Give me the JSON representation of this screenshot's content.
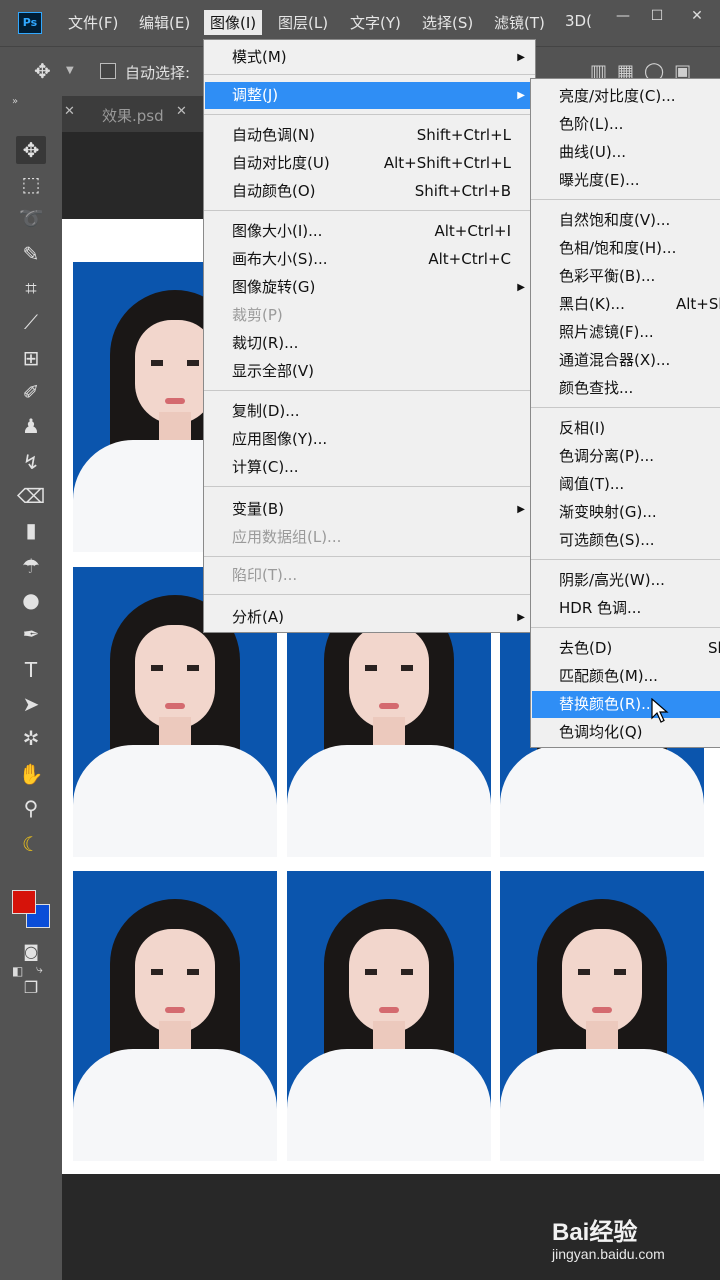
{
  "menubar": {
    "logo": "Ps",
    "items": [
      "文件(F)",
      "编辑(E)",
      "图像(I)",
      "图层(L)",
      "文字(Y)",
      "选择(S)",
      "滤镜(T)",
      "3D("
    ],
    "active_index": 2
  },
  "window_controls": {
    "minimize": "—",
    "maximize": "☐",
    "close": "✕"
  },
  "options_bar": {
    "auto_select_label": "自动选择:",
    "auto_select_checked": false
  },
  "tabs": [
    {
      "label": "效果.psd"
    }
  ],
  "image_menu": {
    "items": [
      {
        "label": "模式(M)",
        "submenu": true
      },
      {
        "label": "调整(J)",
        "submenu": true,
        "highlighted": true
      },
      {
        "label": "自动色调(N)",
        "shortcut": "Shift+Ctrl+L"
      },
      {
        "label": "自动对比度(U)",
        "shortcut": "Alt+Shift+Ctrl+L"
      },
      {
        "label": "自动颜色(O)",
        "shortcut": "Shift+Ctrl+B"
      },
      {
        "label": "图像大小(I)...",
        "shortcut": "Alt+Ctrl+I"
      },
      {
        "label": "画布大小(S)...",
        "shortcut": "Alt+Ctrl+C"
      },
      {
        "label": "图像旋转(G)",
        "submenu": true
      },
      {
        "label": "裁剪(P)",
        "disabled": true
      },
      {
        "label": "裁切(R)..."
      },
      {
        "label": "显示全部(V)"
      },
      {
        "label": "复制(D)..."
      },
      {
        "label": "应用图像(Y)..."
      },
      {
        "label": "计算(C)..."
      },
      {
        "label": "变量(B)",
        "submenu": true
      },
      {
        "label": "应用数据组(L)...",
        "disabled": true
      },
      {
        "label": "陷印(T)...",
        "disabled": true
      },
      {
        "label": "分析(A)",
        "submenu": true
      }
    ]
  },
  "adjust_submenu": {
    "items": [
      {
        "label": "亮度/对比度(C)..."
      },
      {
        "label": "色阶(L)..."
      },
      {
        "label": "曲线(U)..."
      },
      {
        "label": "曝光度(E)..."
      },
      {
        "label": "自然饱和度(V)..."
      },
      {
        "label": "色相/饱和度(H)..."
      },
      {
        "label": "色彩平衡(B)..."
      },
      {
        "label": "黑白(K)...",
        "shortcut": "Alt+Sh"
      },
      {
        "label": "照片滤镜(F)..."
      },
      {
        "label": "通道混合器(X)..."
      },
      {
        "label": "颜色查找..."
      },
      {
        "label": "反相(I)"
      },
      {
        "label": "色调分离(P)..."
      },
      {
        "label": "阈值(T)..."
      },
      {
        "label": "渐变映射(G)..."
      },
      {
        "label": "可选颜色(S)..."
      },
      {
        "label": "阴影/高光(W)..."
      },
      {
        "label": "HDR 色调..."
      },
      {
        "label": "去色(D)",
        "shortcut": "Sh"
      },
      {
        "label": "匹配颜色(M)..."
      },
      {
        "label": "替换颜色(R)...",
        "highlighted": true
      },
      {
        "label": "色调均化(Q)"
      }
    ]
  },
  "colors": {
    "foreground": "#d6130a",
    "background": "#0a4dd8",
    "photo_bg": "#0b55ad",
    "highlight": "#2f8ef5"
  },
  "watermark": {
    "logo": "Bai经验",
    "url": "jingyan.baidu.com"
  }
}
